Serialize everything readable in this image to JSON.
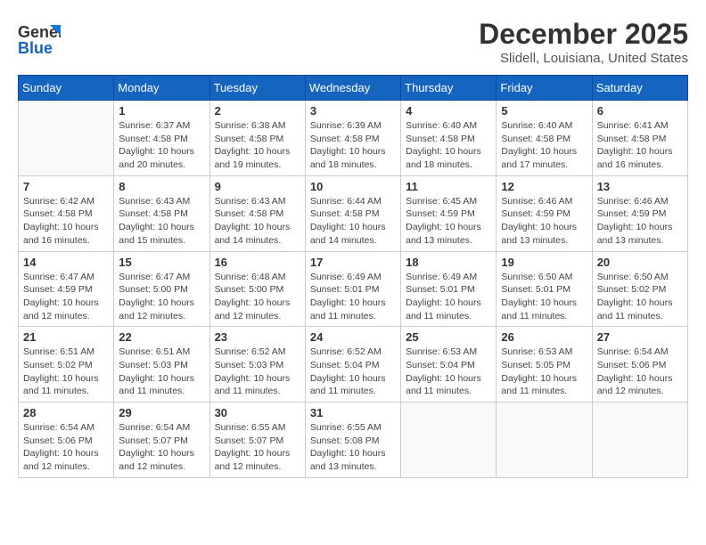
{
  "header": {
    "logo_text_general": "General",
    "logo_text_blue": "Blue",
    "month_title": "December 2025",
    "location": "Slidell, Louisiana, United States"
  },
  "weekdays": [
    "Sunday",
    "Monday",
    "Tuesday",
    "Wednesday",
    "Thursday",
    "Friday",
    "Saturday"
  ],
  "weeks": [
    [
      {
        "day": "",
        "info": ""
      },
      {
        "day": "1",
        "info": "Sunrise: 6:37 AM\nSunset: 4:58 PM\nDaylight: 10 hours\nand 20 minutes."
      },
      {
        "day": "2",
        "info": "Sunrise: 6:38 AM\nSunset: 4:58 PM\nDaylight: 10 hours\nand 19 minutes."
      },
      {
        "day": "3",
        "info": "Sunrise: 6:39 AM\nSunset: 4:58 PM\nDaylight: 10 hours\nand 18 minutes."
      },
      {
        "day": "4",
        "info": "Sunrise: 6:40 AM\nSunset: 4:58 PM\nDaylight: 10 hours\nand 18 minutes."
      },
      {
        "day": "5",
        "info": "Sunrise: 6:40 AM\nSunset: 4:58 PM\nDaylight: 10 hours\nand 17 minutes."
      },
      {
        "day": "6",
        "info": "Sunrise: 6:41 AM\nSunset: 4:58 PM\nDaylight: 10 hours\nand 16 minutes."
      }
    ],
    [
      {
        "day": "7",
        "info": "Sunrise: 6:42 AM\nSunset: 4:58 PM\nDaylight: 10 hours\nand 16 minutes."
      },
      {
        "day": "8",
        "info": "Sunrise: 6:43 AM\nSunset: 4:58 PM\nDaylight: 10 hours\nand 15 minutes."
      },
      {
        "day": "9",
        "info": "Sunrise: 6:43 AM\nSunset: 4:58 PM\nDaylight: 10 hours\nand 14 minutes."
      },
      {
        "day": "10",
        "info": "Sunrise: 6:44 AM\nSunset: 4:58 PM\nDaylight: 10 hours\nand 14 minutes."
      },
      {
        "day": "11",
        "info": "Sunrise: 6:45 AM\nSunset: 4:59 PM\nDaylight: 10 hours\nand 13 minutes."
      },
      {
        "day": "12",
        "info": "Sunrise: 6:46 AM\nSunset: 4:59 PM\nDaylight: 10 hours\nand 13 minutes."
      },
      {
        "day": "13",
        "info": "Sunrise: 6:46 AM\nSunset: 4:59 PM\nDaylight: 10 hours\nand 13 minutes."
      }
    ],
    [
      {
        "day": "14",
        "info": "Sunrise: 6:47 AM\nSunset: 4:59 PM\nDaylight: 10 hours\nand 12 minutes."
      },
      {
        "day": "15",
        "info": "Sunrise: 6:47 AM\nSunset: 5:00 PM\nDaylight: 10 hours\nand 12 minutes."
      },
      {
        "day": "16",
        "info": "Sunrise: 6:48 AM\nSunset: 5:00 PM\nDaylight: 10 hours\nand 12 minutes."
      },
      {
        "day": "17",
        "info": "Sunrise: 6:49 AM\nSunset: 5:01 PM\nDaylight: 10 hours\nand 11 minutes."
      },
      {
        "day": "18",
        "info": "Sunrise: 6:49 AM\nSunset: 5:01 PM\nDaylight: 10 hours\nand 11 minutes."
      },
      {
        "day": "19",
        "info": "Sunrise: 6:50 AM\nSunset: 5:01 PM\nDaylight: 10 hours\nand 11 minutes."
      },
      {
        "day": "20",
        "info": "Sunrise: 6:50 AM\nSunset: 5:02 PM\nDaylight: 10 hours\nand 11 minutes."
      }
    ],
    [
      {
        "day": "21",
        "info": "Sunrise: 6:51 AM\nSunset: 5:02 PM\nDaylight: 10 hours\nand 11 minutes."
      },
      {
        "day": "22",
        "info": "Sunrise: 6:51 AM\nSunset: 5:03 PM\nDaylight: 10 hours\nand 11 minutes."
      },
      {
        "day": "23",
        "info": "Sunrise: 6:52 AM\nSunset: 5:03 PM\nDaylight: 10 hours\nand 11 minutes."
      },
      {
        "day": "24",
        "info": "Sunrise: 6:52 AM\nSunset: 5:04 PM\nDaylight: 10 hours\nand 11 minutes."
      },
      {
        "day": "25",
        "info": "Sunrise: 6:53 AM\nSunset: 5:04 PM\nDaylight: 10 hours\nand 11 minutes."
      },
      {
        "day": "26",
        "info": "Sunrise: 6:53 AM\nSunset: 5:05 PM\nDaylight: 10 hours\nand 11 minutes."
      },
      {
        "day": "27",
        "info": "Sunrise: 6:54 AM\nSunset: 5:06 PM\nDaylight: 10 hours\nand 12 minutes."
      }
    ],
    [
      {
        "day": "28",
        "info": "Sunrise: 6:54 AM\nSunset: 5:06 PM\nDaylight: 10 hours\nand 12 minutes."
      },
      {
        "day": "29",
        "info": "Sunrise: 6:54 AM\nSunset: 5:07 PM\nDaylight: 10 hours\nand 12 minutes."
      },
      {
        "day": "30",
        "info": "Sunrise: 6:55 AM\nSunset: 5:07 PM\nDaylight: 10 hours\nand 12 minutes."
      },
      {
        "day": "31",
        "info": "Sunrise: 6:55 AM\nSunset: 5:08 PM\nDaylight: 10 hours\nand 13 minutes."
      },
      {
        "day": "",
        "info": ""
      },
      {
        "day": "",
        "info": ""
      },
      {
        "day": "",
        "info": ""
      }
    ]
  ]
}
